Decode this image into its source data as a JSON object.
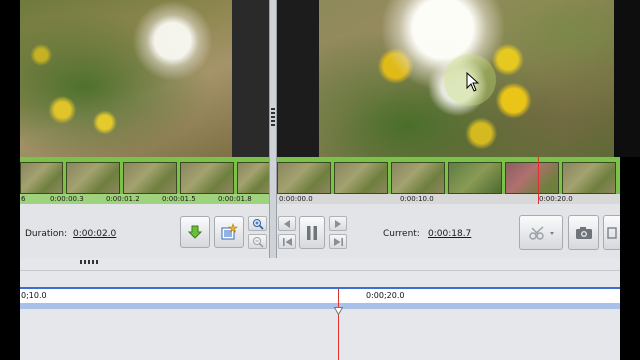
{
  "filmstrip": {
    "left_ticks": [
      "6",
      "0:00:00.3",
      "0:00:01.2",
      "0:00:01.5",
      "0:00:01.8"
    ],
    "right_ticks": [
      "0:00:00.0",
      "0:00:10.0",
      "0:00:20.0"
    ]
  },
  "trim": {
    "duration_label": "Duration:",
    "duration_value": "0:00:02.0"
  },
  "player": {
    "current_label": "Current:",
    "current_value": "0:00:18.7"
  },
  "timeline": {
    "left_label": "0;10.0",
    "mid_label": "0:00;20.0"
  },
  "colors": {
    "accent_green": "#7ac24a",
    "playhead_red": "#e03030",
    "timeline_blue": "#3c6fd6"
  }
}
